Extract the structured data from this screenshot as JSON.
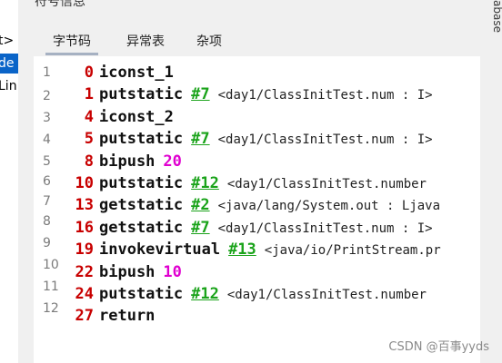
{
  "header": {
    "clipped_title": "符号信息"
  },
  "left_tree": {
    "items": [
      {
        "label": "t>",
        "selected": false
      },
      {
        "label": "de",
        "selected": true
      },
      {
        "label": "Lin",
        "selected": false
      }
    ]
  },
  "right_edge_label": "abase",
  "tabs": [
    {
      "label": "字节码",
      "active": true
    },
    {
      "label": "异常表",
      "active": false
    },
    {
      "label": "杂项",
      "active": false
    }
  ],
  "line_numbers": [
    "1",
    "2",
    "3",
    "4",
    "5",
    "6",
    "7",
    "8",
    "9",
    "10",
    "11",
    "12"
  ],
  "instructions": [
    {
      "offset": "0",
      "opcode": "iconst_1",
      "ref": "",
      "operand": "",
      "comment": ""
    },
    {
      "offset": "1",
      "opcode": "putstatic",
      "ref": "#7",
      "operand": "",
      "comment": "<day1/ClassInitTest.num : I>"
    },
    {
      "offset": "4",
      "opcode": "iconst_2",
      "ref": "",
      "operand": "",
      "comment": ""
    },
    {
      "offset": "5",
      "opcode": "putstatic",
      "ref": "#7",
      "operand": "",
      "comment": "<day1/ClassInitTest.num : I>"
    },
    {
      "offset": "8",
      "opcode": "bipush",
      "ref": "",
      "operand": "20",
      "comment": ""
    },
    {
      "offset": "10",
      "opcode": "putstatic",
      "ref": "#12",
      "operand": "",
      "comment": "<day1/ClassInitTest.number"
    },
    {
      "offset": "13",
      "opcode": "getstatic",
      "ref": "#2",
      "operand": "",
      "comment": "<java/lang/System.out : Ljava"
    },
    {
      "offset": "16",
      "opcode": "getstatic",
      "ref": "#7",
      "operand": "",
      "comment": "<day1/ClassInitTest.num : I>"
    },
    {
      "offset": "19",
      "opcode": "invokevirtual",
      "ref": "#13",
      "operand": "",
      "comment": "<java/io/PrintStream.pr"
    },
    {
      "offset": "22",
      "opcode": "bipush",
      "ref": "",
      "operand": "10",
      "comment": ""
    },
    {
      "offset": "24",
      "opcode": "putstatic",
      "ref": "#12",
      "operand": "",
      "comment": "<day1/ClassInitTest.number"
    },
    {
      "offset": "27",
      "opcode": "return",
      "ref": "",
      "operand": "",
      "comment": ""
    }
  ],
  "watermark": "CSDN @百事yyds",
  "colors": {
    "offset": "#c80000",
    "reference": "#1aa31a",
    "number": "#e000d0",
    "selection": "#0a64c8",
    "tab_underline": "#a6b1c2"
  }
}
